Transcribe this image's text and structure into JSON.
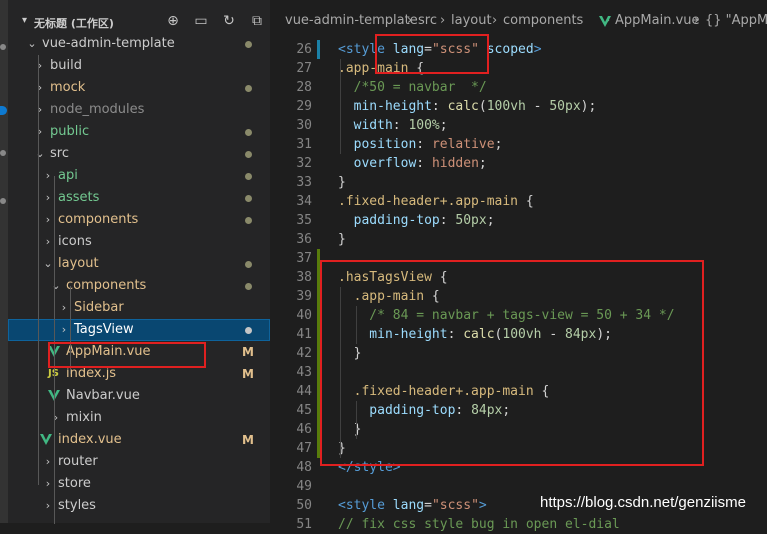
{
  "explorer": {
    "workspace_title": "无标题 (工作区)",
    "actions": [
      "new-file-icon",
      "new-folder-icon",
      "refresh-icon",
      "collapse-icon"
    ],
    "items": [
      {
        "name": "vue-admin-template",
        "kind": "folder",
        "open": true,
        "color": "#cccccc",
        "status": "dot"
      },
      {
        "name": "build",
        "kind": "folder",
        "open": false,
        "color": "#cccccc",
        "status": ""
      },
      {
        "name": "mock",
        "kind": "folder",
        "open": false,
        "color": "#e2c08d",
        "status": "dot"
      },
      {
        "name": "node_modules",
        "kind": "folder",
        "open": false,
        "color": "#8c8c8c",
        "status": ""
      },
      {
        "name": "public",
        "kind": "folder",
        "open": false,
        "color": "#73c991",
        "status": "dot"
      },
      {
        "name": "src",
        "kind": "folder",
        "open": true,
        "color": "#cccccc",
        "status": "dot"
      },
      {
        "name": "api",
        "kind": "folder",
        "open": false,
        "color": "#73c991",
        "status": "dot"
      },
      {
        "name": "assets",
        "kind": "folder",
        "open": false,
        "color": "#73c991",
        "status": "dot"
      },
      {
        "name": "components",
        "kind": "folder",
        "open": false,
        "color": "#e2c08d",
        "status": "dot"
      },
      {
        "name": "icons",
        "kind": "folder",
        "open": false,
        "color": "#cccccc",
        "status": ""
      },
      {
        "name": "layout",
        "kind": "folder",
        "open": true,
        "color": "#e2c08d",
        "status": "dot"
      },
      {
        "name": "components",
        "kind": "folder",
        "open": true,
        "color": "#e2c08d",
        "status": "dot"
      },
      {
        "name": "Sidebar",
        "kind": "folder",
        "open": false,
        "color": "#e2c08d",
        "status": ""
      },
      {
        "name": "TagsView",
        "kind": "folder",
        "open": false,
        "color": "#ffffff",
        "status": "dot",
        "selected": true
      },
      {
        "name": "AppMain.vue",
        "kind": "vue",
        "color": "#e2c08d",
        "status": "M"
      },
      {
        "name": "index.js",
        "kind": "js",
        "color": "#e2c08d",
        "status": "M"
      },
      {
        "name": "Navbar.vue",
        "kind": "vue",
        "color": "#cccccc",
        "status": ""
      },
      {
        "name": "mixin",
        "kind": "folder",
        "open": false,
        "color": "#cccccc",
        "status": ""
      },
      {
        "name": "index.vue",
        "kind": "vue",
        "color": "#e2c08d",
        "status": "M"
      },
      {
        "name": "router",
        "kind": "folder",
        "open": false,
        "color": "#cccccc",
        "status": ""
      },
      {
        "name": "store",
        "kind": "folder",
        "open": false,
        "color": "#cccccc",
        "status": ""
      },
      {
        "name": "styles",
        "kind": "folder",
        "open": false,
        "color": "#cccccc",
        "status": ""
      }
    ]
  },
  "breadcrumb": [
    "vue-admin-template",
    "src",
    "layout",
    "components",
    "AppMain.vue",
    "{} \"AppMa"
  ],
  "editor": {
    "lines": [
      {
        "n": "26",
        "t": [
          [
            "tag",
            "<style "
          ],
          [
            "attr",
            "lang"
          ],
          [
            "brace",
            "="
          ],
          [
            "str",
            "\"scss\""
          ],
          [
            "attr",
            " scoped"
          ],
          [
            "tag",
            ">"
          ]
        ]
      },
      {
        "n": "27",
        "t": [
          [
            "sel",
            ".app-main"
          ],
          [
            "brace",
            " {"
          ]
        ]
      },
      {
        "n": "28",
        "t": [
          [
            "cmt",
            "  /*50 = navbar  */"
          ]
        ]
      },
      {
        "n": "29",
        "t": [
          [
            "prop",
            "  min-height"
          ],
          [
            "brace",
            ": "
          ],
          [
            "fn",
            "calc"
          ],
          [
            "brace",
            "("
          ],
          [
            "num",
            "100vh"
          ],
          [
            "brace",
            " - "
          ],
          [
            "num",
            "50px"
          ],
          [
            "brace",
            ");"
          ]
        ]
      },
      {
        "n": "30",
        "t": [
          [
            "prop",
            "  width"
          ],
          [
            "brace",
            ": "
          ],
          [
            "num",
            "100%"
          ],
          [
            "brace",
            ";"
          ]
        ]
      },
      {
        "n": "31",
        "t": [
          [
            "prop",
            "  position"
          ],
          [
            "brace",
            ": "
          ],
          [
            "val",
            "relative"
          ],
          [
            "brace",
            ";"
          ]
        ]
      },
      {
        "n": "32",
        "t": [
          [
            "prop",
            "  overflow"
          ],
          [
            "brace",
            ": "
          ],
          [
            "val",
            "hidden"
          ],
          [
            "brace",
            ";"
          ]
        ]
      },
      {
        "n": "33",
        "t": [
          [
            "brace",
            "}"
          ]
        ]
      },
      {
        "n": "34",
        "t": [
          [
            "sel",
            ".fixed-header+.app-main"
          ],
          [
            "brace",
            " {"
          ]
        ]
      },
      {
        "n": "35",
        "t": [
          [
            "prop",
            "  padding-top"
          ],
          [
            "brace",
            ": "
          ],
          [
            "num",
            "50px"
          ],
          [
            "brace",
            ";"
          ]
        ]
      },
      {
        "n": "36",
        "t": [
          [
            "brace",
            "}"
          ]
        ]
      },
      {
        "n": "37",
        "t": []
      },
      {
        "n": "38",
        "t": [
          [
            "sel",
            ".hasTagsView"
          ],
          [
            "brace",
            " {"
          ]
        ]
      },
      {
        "n": "39",
        "t": [
          [
            "sel",
            "  .app-main"
          ],
          [
            "brace",
            " {"
          ]
        ]
      },
      {
        "n": "40",
        "t": [
          [
            "cmt",
            "    /* 84 = navbar + tags-view = 50 + 34 */"
          ]
        ]
      },
      {
        "n": "41",
        "t": [
          [
            "prop",
            "    min-height"
          ],
          [
            "brace",
            ": "
          ],
          [
            "fn",
            "calc"
          ],
          [
            "brace",
            "("
          ],
          [
            "num",
            "100vh"
          ],
          [
            "brace",
            " - "
          ],
          [
            "num",
            "84px"
          ],
          [
            "brace",
            ");"
          ]
        ]
      },
      {
        "n": "42",
        "t": [
          [
            "brace",
            "  }"
          ]
        ]
      },
      {
        "n": "43",
        "t": []
      },
      {
        "n": "44",
        "t": [
          [
            "sel",
            "  .fixed-header+.app-main"
          ],
          [
            "brace",
            " {"
          ]
        ]
      },
      {
        "n": "45",
        "t": [
          [
            "prop",
            "    padding-top"
          ],
          [
            "brace",
            ": "
          ],
          [
            "num",
            "84px"
          ],
          [
            "brace",
            ";"
          ]
        ]
      },
      {
        "n": "46",
        "t": [
          [
            "brace",
            "  }"
          ]
        ]
      },
      {
        "n": "47",
        "t": [
          [
            "brace",
            "}"
          ]
        ]
      },
      {
        "n": "48",
        "t": [
          [
            "tag",
            "</style>"
          ]
        ]
      },
      {
        "n": "49",
        "t": []
      },
      {
        "n": "50",
        "t": [
          [
            "tag",
            "<style "
          ],
          [
            "attr",
            "lang"
          ],
          [
            "brace",
            "="
          ],
          [
            "str",
            "\"scss\""
          ],
          [
            "tag",
            ">"
          ]
        ]
      },
      {
        "n": "51",
        "t": [
          [
            "cmt",
            "// fix css style bug in open el-dial"
          ]
        ]
      }
    ]
  },
  "watermark": "https://blog.csdn.net/genziisme",
  "colors": {
    "accent": "#0e639c",
    "highlight_box": "#e02020",
    "git_modified": "#1b81a8",
    "git_added": "#587c0c"
  }
}
